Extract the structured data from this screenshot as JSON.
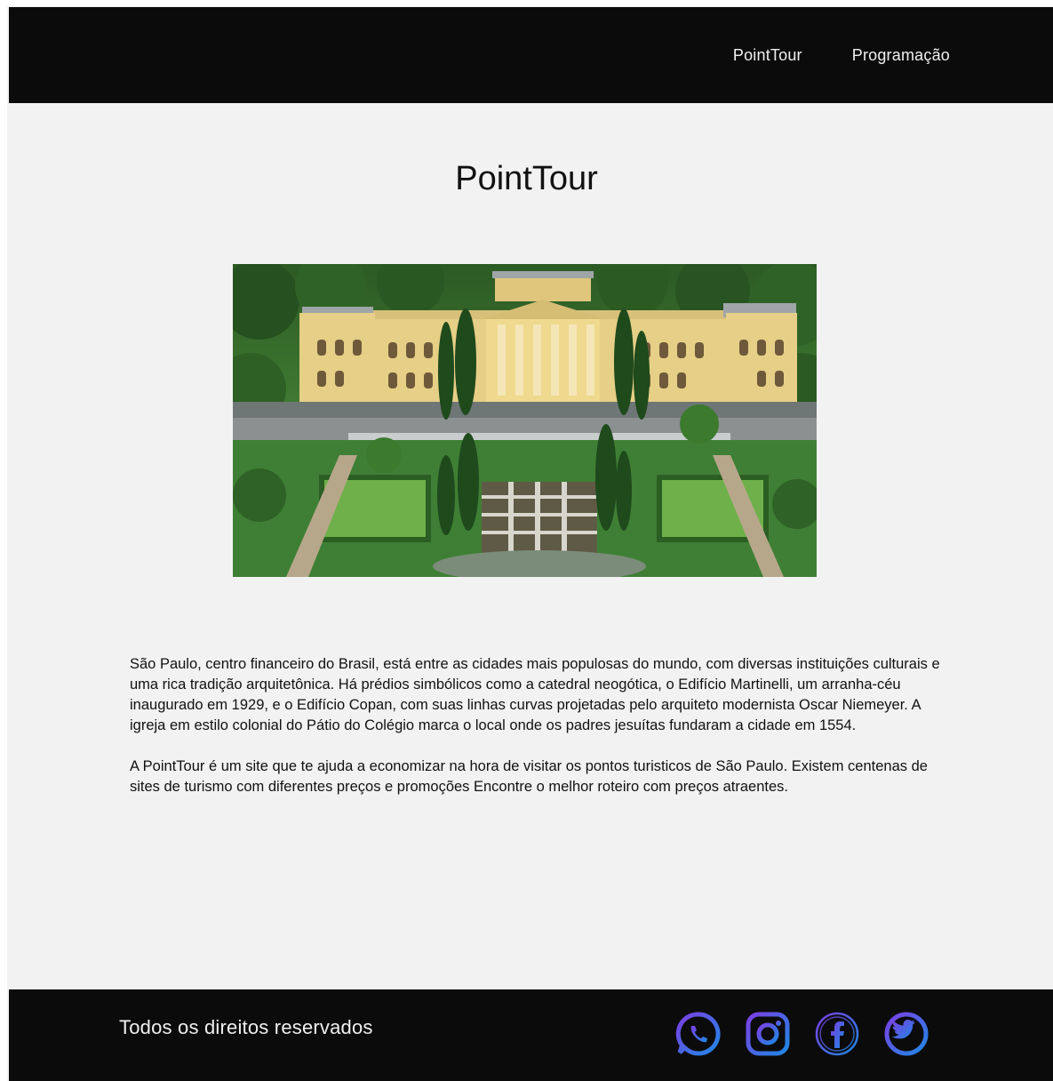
{
  "header": {
    "nav": [
      {
        "label": "PointTour"
      },
      {
        "label": "Programação"
      }
    ]
  },
  "main": {
    "title": "PointTour",
    "hero_image": {
      "icon": "museu-paulista-photo"
    },
    "paragraphs": [
      "São Paulo, centro financeiro do Brasil, está entre as cidades mais populosas do mundo, com diversas instituições culturais e uma rica tradição arquitetônica. Há prédios simbólicos como a catedral neogótica, o Edifício Martinelli, um arranha-céu inaugurado em 1929, e o Edifício Copan, com suas linhas curvas projetadas pelo arquiteto modernista Oscar Niemeyer. A igreja em estilo colonial do Pátio do Colégio marca o local onde os padres jesuítas fundaram a cidade em 1554.",
      "A PointTour é um site que te ajuda a economizar na hora de visitar os  pontos turisticos de São Paulo. Existem centenas de sites de turismo com diferentes preços e promoções Encontre o melhor roteiro com preços atraentes."
    ]
  },
  "footer": {
    "copyright": "Todos os direitos reservados",
    "social": [
      {
        "icon": "whatsapp-icon"
      },
      {
        "icon": "instagram-icon"
      },
      {
        "icon": "facebook-icon"
      },
      {
        "icon": "twitter-icon"
      }
    ]
  },
  "colors": {
    "header_bg": "#0b0b0b",
    "page_bg": "#f2f2f2",
    "footer_bg": "#0b0b0b",
    "social_gradient_start": "#7b3fe4",
    "social_gradient_end": "#1e88e5"
  }
}
